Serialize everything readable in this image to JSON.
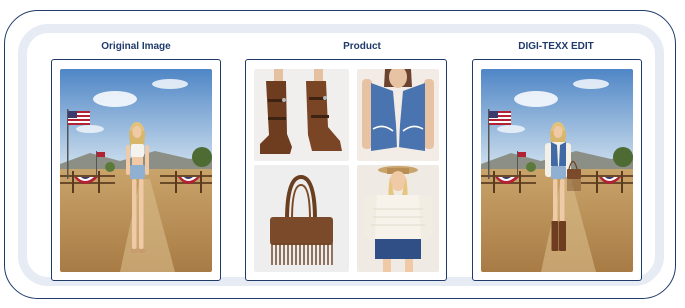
{
  "columns": [
    {
      "title": "Original Image"
    },
    {
      "title": "Product"
    },
    {
      "title": "DIGI-TEXX EDIT"
    }
  ],
  "icons": {
    "flag": "us-flag-icon",
    "products": [
      "boots",
      "denim-vest",
      "fringe-bag",
      "knit-sweater-denim-skirt"
    ]
  },
  "colors": {
    "border": "#1f3a6b",
    "frame": "#e6ebf4"
  }
}
